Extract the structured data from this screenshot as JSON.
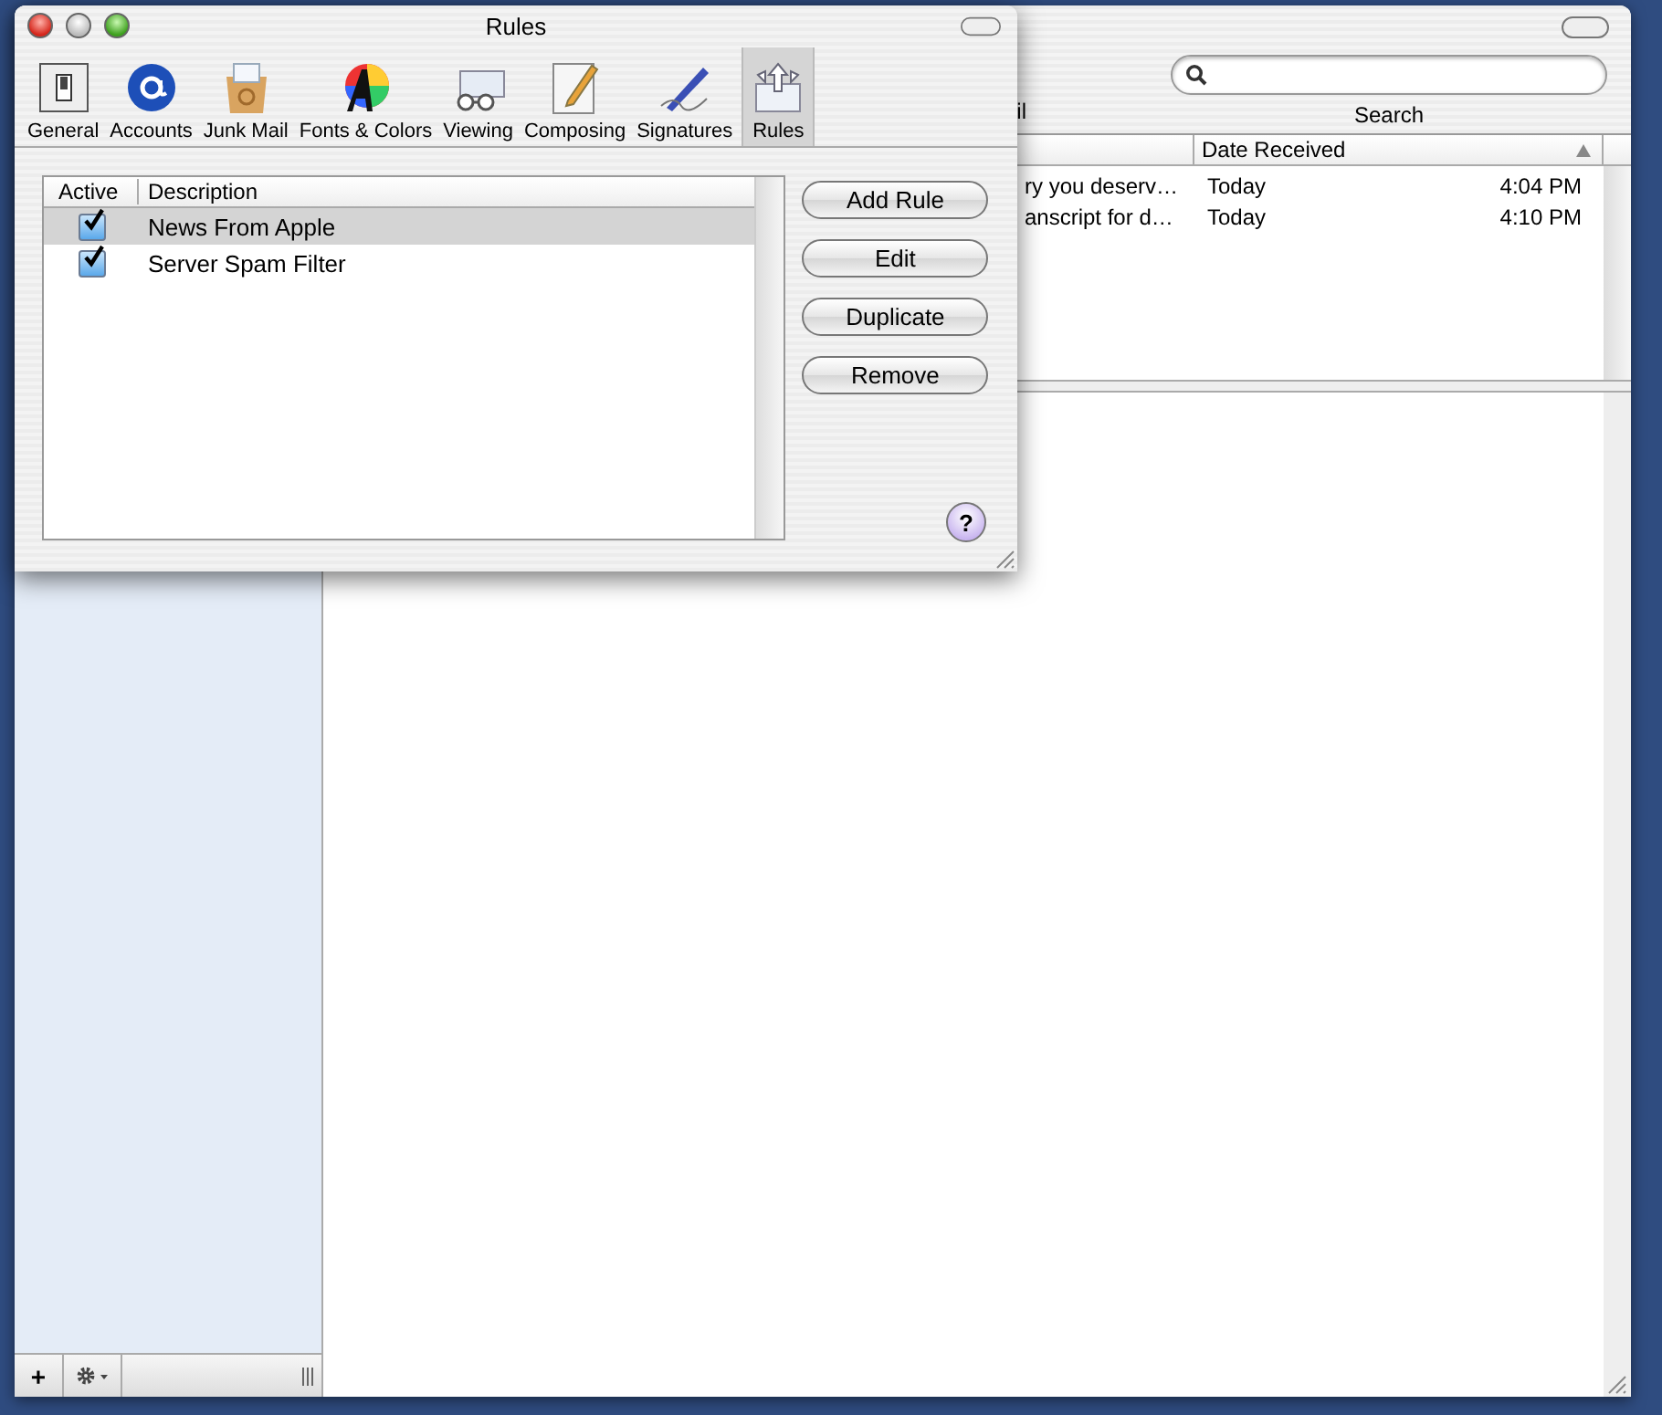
{
  "main_window": {
    "toolbar": {
      "partial_label": "il",
      "search": {
        "label": "Search"
      }
    },
    "message_list": {
      "columns": [
        "Date Received"
      ],
      "rows": [
        {
          "subject": "ry you deserv…",
          "date": "Today",
          "time": "4:04 PM"
        },
        {
          "subject": "anscript for d…",
          "date": "Today",
          "time": "4:10 PM"
        }
      ]
    },
    "sidebar_buttons": [
      "+"
    ]
  },
  "rules_window": {
    "title": "Rules",
    "tabs": [
      {
        "label": "General",
        "selected": false
      },
      {
        "label": "Accounts",
        "selected": false
      },
      {
        "label": "Junk Mail",
        "selected": false
      },
      {
        "label": "Fonts & Colors",
        "selected": false
      },
      {
        "label": "Viewing",
        "selected": false
      },
      {
        "label": "Composing",
        "selected": false
      },
      {
        "label": "Signatures",
        "selected": false
      },
      {
        "label": "Rules",
        "selected": true
      }
    ],
    "table": {
      "columns": [
        "Active",
        "Description"
      ],
      "rows": [
        {
          "active": true,
          "description": "News From Apple",
          "selected": true
        },
        {
          "active": true,
          "description": "Server Spam Filter",
          "selected": false
        }
      ]
    },
    "buttons": [
      "Add Rule",
      "Edit",
      "Duplicate",
      "Remove"
    ],
    "help": "?"
  }
}
